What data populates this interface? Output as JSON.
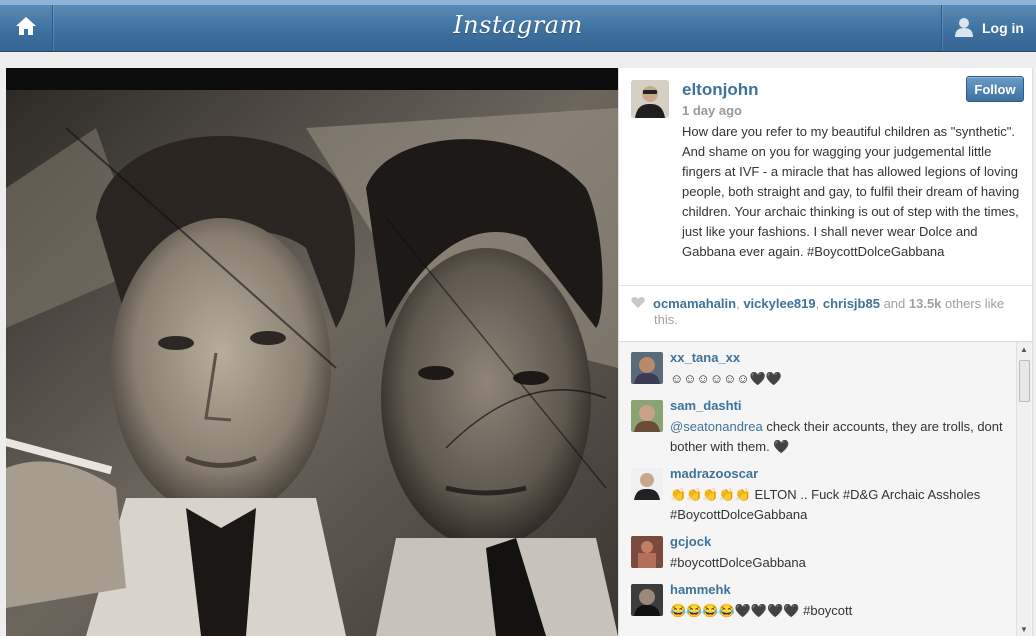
{
  "header": {
    "brand": "Instagram",
    "login_label": "Log in"
  },
  "post": {
    "username": "eltonjohn",
    "follow_label": "Follow",
    "timeago": "1 day ago",
    "caption": "How dare you refer to my beautiful children as \"synthetic\". And shame on you for wagging your judgemental little fingers at IVF - a miracle that has allowed legions of loving people, both straight and gay, to fulfil their dream of having children. Your archaic thinking is out of step with the times, just like your fashions. I shall never wear Dolce and Gabbana ever again. #BoycottDolceGabbana"
  },
  "likes": {
    "user1": "ocmamahalin",
    "sep1": ", ",
    "user2": "vickylee819",
    "sep2": ", ",
    "user3": "chrisjb85",
    "and": " and ",
    "count": "13.5k",
    "suffix": " others like",
    "suffix2": "this."
  },
  "comments": [
    {
      "user": "xx_tana_xx",
      "text": "☺☺☺☺☺☺🖤🖤"
    },
    {
      "user": "sam_dashti",
      "mention": "@seatonandrea",
      "text": " check their accounts, they are trolls, dont bother with them. 🖤"
    },
    {
      "user": "madrazooscar",
      "text": "👏👏👏👏👏 ELTON .. Fuck #D&G Archaic Assholes #BoycottDolceGabbana"
    },
    {
      "user": "gcjock",
      "text": "#boycottDolceGabbana"
    },
    {
      "user": "hammehk",
      "text": "😂😂😂😂🖤🖤🖤🖤 #boycott"
    }
  ],
  "colors": {
    "link_blue": "#3f729b",
    "topbar_blue": "#3f71a0"
  },
  "icons": [
    "home-icon",
    "user-icon",
    "heart-icon"
  ]
}
